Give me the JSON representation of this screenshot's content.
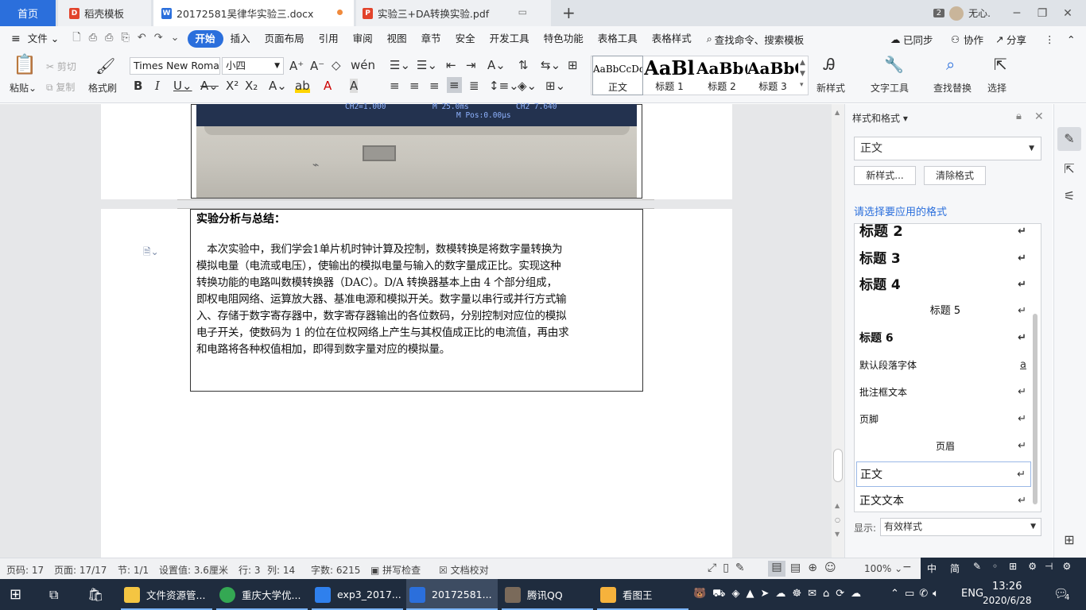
{
  "titlebar": {
    "tab_home": "首页",
    "tab_templates": "稻壳模板",
    "tab_doc": "20172581吴律华实验三.docx",
    "tab_pdf": "实验三+DA转换实验.pdf",
    "badge": "2",
    "user": "无心.",
    "win_min": "─",
    "win_restore": "❐",
    "win_close": "✕"
  },
  "menubar": {
    "file": "文件",
    "items": [
      "开始",
      "插入",
      "页面布局",
      "引用",
      "审阅",
      "视图",
      "章节",
      "安全",
      "开发工具",
      "特色功能",
      "表格工具",
      "表格样式"
    ],
    "active_index": 0,
    "search": "查找命令、搜索模板",
    "sync": "已同步",
    "collab": "协作",
    "share": "分享"
  },
  "ribbon": {
    "paste": "粘贴",
    "cut": "剪切",
    "copy": "复制",
    "format_painter": "格式刷",
    "font_name": "Times New Roma",
    "font_size": "小四",
    "styles": [
      {
        "preview": "AaBbCcDd",
        "label": "正文"
      },
      {
        "preview": "AaBl",
        "label": "标题 1"
      },
      {
        "preview": "AaBb(",
        "label": "标题 2"
      },
      {
        "preview": "AaBbC",
        "label": "标题 3"
      }
    ],
    "new_style": "新样式",
    "text_tools": "文字工具",
    "find_replace": "查找替换",
    "select": "选择"
  },
  "document": {
    "scope_text": {
      "ch2": "CH2=1.000",
      "m": "M 25.0ms",
      "ch2b": "CH2 7.640",
      "mpos": "M Pos:0.00μs"
    },
    "section_title": "实验分析与总结：",
    "body_lines": [
      "　本次实验中，我们学会1单片机时钟计算及控制，数模转换是将数字量转换为",
      "模拟电量（电流或电压），使输出的模拟电量与输入的数字量成正比。实现这种",
      "转换功能的电路叫数模转换器（DAC）。D/A 转换器基本上由 4 个部分组成，",
      "即权电阻网络、运算放大器、基准电源和模拟开关。数字量以串行或并行方式输",
      "入、存储于数字寄存器中，数字寄存器输出的各位数码，分别控制对应位的模拟",
      "电子开关，使数码为 1 的位在位权网络上产生与其权值成正比的电流值，再由求",
      "和电路将各种权值相加，即得到数字量对应的模拟量。"
    ]
  },
  "pane": {
    "title": "样式和格式",
    "current_style": "正文",
    "new_style_btn": "新样式...",
    "clear_btn": "清除格式",
    "apply_label": "请选择要应用的格式",
    "styles": [
      "标题 2",
      "标题 3",
      "标题 4",
      "标题 5",
      "标题 6",
      "默认段落字体",
      "批注框文本",
      "页脚",
      "页眉",
      "正文",
      "正文文本"
    ],
    "selected_style": "正文",
    "show_label": "显示:",
    "show_value": "有效样式"
  },
  "statusbar": {
    "page_num": "页码: 17",
    "page": "页面: 17/17",
    "section": "节: 1/1",
    "setting": "设置值: 3.6厘米",
    "row": "行: 3",
    "col": "列: 14",
    "words": "字数: 6215",
    "spell": "拼写检查",
    "proof": "文档校对",
    "zoom": "100%"
  },
  "taskbar": {
    "items": [
      "文件资源管...",
      "重庆大学优...",
      "exp3_2017...",
      "20172581...",
      "腾讯QQ",
      "看图王"
    ],
    "ime_cn": "中",
    "ime_simp": "简",
    "lang": "ENG",
    "time": "13:26",
    "date": "2020/6/28",
    "notif_count": "4"
  },
  "colors": {
    "accent": "#2b6fdc",
    "taskbar": "#1f2c3e"
  }
}
